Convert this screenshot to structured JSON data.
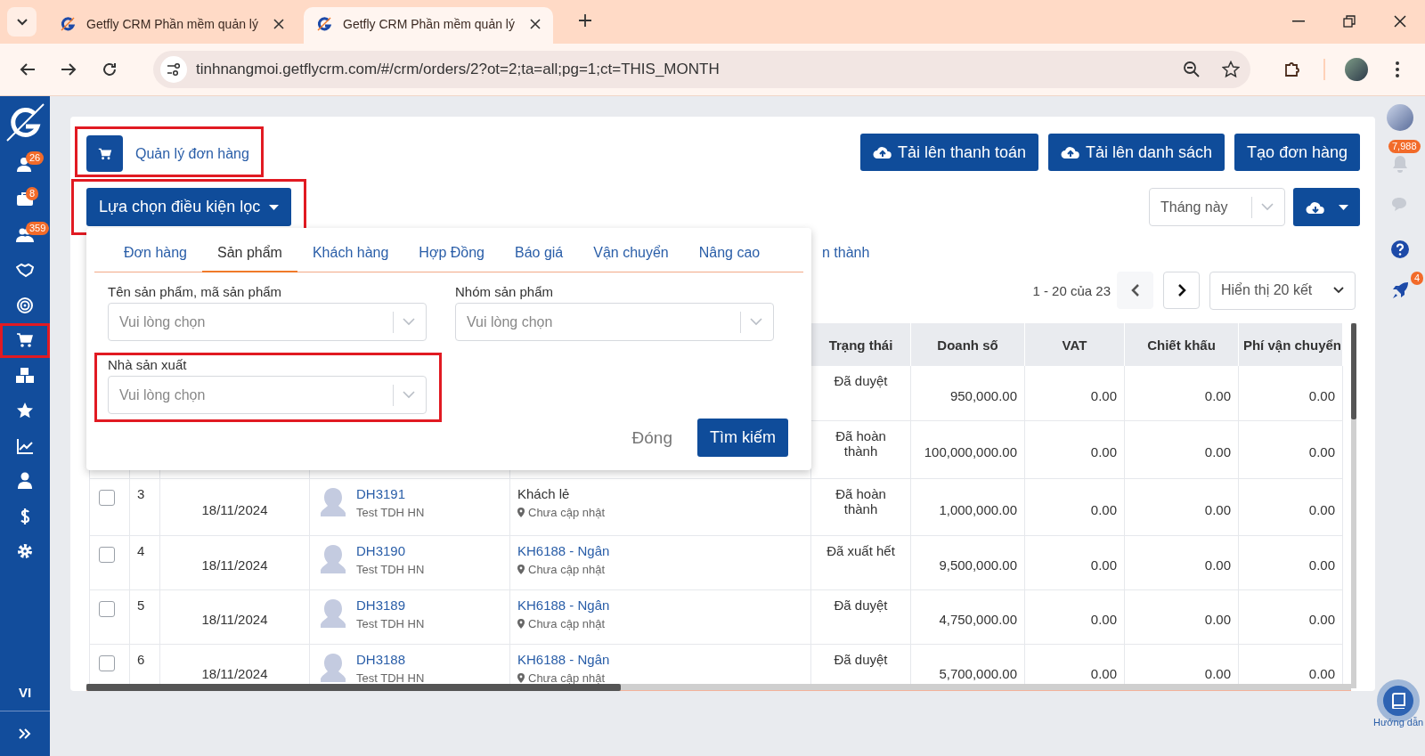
{
  "browser": {
    "tabs": [
      {
        "title": "Getfly CRM Phần mềm quản lý",
        "selected": false
      },
      {
        "title": "Getfly CRM Phần mềm quản lý",
        "selected": true
      }
    ],
    "url": "tinhnangmoi.getflycrm.com/#/crm/orders/2?ot=2;ta=all;pg=1;ct=THIS_MONTH"
  },
  "sidebar": {
    "items": [
      {
        "badge": "26",
        "highlighted": false
      },
      {
        "badge": "8",
        "highlighted": false
      },
      {
        "badge": "359",
        "highlighted": false
      },
      {
        "highlighted": false
      },
      {
        "highlighted": false
      },
      {
        "highlighted": true
      },
      {
        "highlighted": false
      },
      {
        "highlighted": false
      },
      {
        "highlighted": false
      },
      {
        "highlighted": false
      },
      {
        "highlighted": false
      },
      {
        "highlighted": false
      }
    ],
    "language": "VI"
  },
  "page": {
    "title": "Quản lý đơn hàng",
    "title_highlighted": true,
    "filter_button": {
      "label": "Lựa chọn điều kiện lọc",
      "highlighted": true
    },
    "actions": [
      {
        "label": "Tải lên thanh toán",
        "kind": "upload"
      },
      {
        "label": "Tải lên danh sách",
        "kind": "upload"
      },
      {
        "label": "Tạo đơn hàng",
        "kind": "plain"
      }
    ],
    "period_select": {
      "value": "Tháng này"
    },
    "status_tab_fragment": "n thành",
    "pagination": {
      "range": "1 - 20 của 23",
      "page_size": "Hiển thị 20 kết"
    }
  },
  "filter_panel": {
    "tabs": [
      {
        "label": "Đơn hàng",
        "selected": false
      },
      {
        "label": "Sản phẩm",
        "selected": true
      },
      {
        "label": "Khách hàng",
        "selected": false
      },
      {
        "label": "Hợp Đồng",
        "selected": false
      },
      {
        "label": "Báo giá",
        "selected": false
      },
      {
        "label": "Vận chuyển",
        "selected": false
      },
      {
        "label": "Nâng cao",
        "selected": false
      }
    ],
    "fields": [
      {
        "label": "Tên sản phẩm, mã sản phẩm",
        "placeholder": "Vui lòng chọn",
        "highlighted": false
      },
      {
        "label": "Nhóm sản phẩm",
        "placeholder": "Vui lòng chọn",
        "highlighted": false
      },
      {
        "label": "Nhà sản xuất",
        "placeholder": "Vui lòng chọn",
        "highlighted": true
      }
    ],
    "close": "Đóng",
    "search": "Tìm kiếm"
  },
  "table": {
    "columns": [
      "Trạng thái",
      "Doanh số",
      "VAT",
      "Chiết khấu",
      "Phí vận chuyển"
    ],
    "rows": [
      {
        "status": "Đã duyệt",
        "revenue": "950,000.00",
        "vat": "0.00",
        "discount": "0.00",
        "shipping": "0.00"
      },
      {
        "status": "Đã hoàn thành",
        "revenue": "100,000,000.00",
        "vat": "0.00",
        "discount": "0.00",
        "shipping": "0.00"
      },
      {
        "checked": false,
        "index": "3",
        "date": "18/11/2024",
        "order_code": "DH3191",
        "creator": "Test TDH HN",
        "customer": {
          "name": "Khách lẻ",
          "linked": false
        },
        "location": "Chưa cập nhật",
        "status": "Đã hoàn thành",
        "revenue": "1,000,000.00",
        "vat": "0.00",
        "discount": "0.00",
        "shipping": "0.00"
      },
      {
        "checked": false,
        "index": "4",
        "date": "18/11/2024",
        "order_code": "DH3190",
        "creator": "Test TDH HN",
        "customer": {
          "name": "KH6188 - Ngân",
          "linked": true
        },
        "location": "Chưa cập nhật",
        "status": "Đã xuất hết",
        "revenue": "9,500,000.00",
        "vat": "0.00",
        "discount": "0.00",
        "shipping": "0.00"
      },
      {
        "checked": false,
        "index": "5",
        "date": "18/11/2024",
        "order_code": "DH3189",
        "creator": "Test TDH HN",
        "customer": {
          "name": "KH6188 - Ngân",
          "linked": true
        },
        "location": "Chưa cập nhật",
        "status": "Đã duyệt",
        "revenue": "4,750,000.00",
        "vat": "0.00",
        "discount": "0.00",
        "shipping": "0.00"
      },
      {
        "checked": false,
        "index": "6",
        "date": "18/11/2024",
        "order_code": "DH3188",
        "creator": "Test TDH HN",
        "customer": {
          "name": "KH6188 - Ngân",
          "linked": true
        },
        "location": "Chưa cập nhật",
        "status": "Đã duyệt",
        "revenue": "5,700,000.00",
        "vat": "0.00",
        "discount": "0.00",
        "shipping": "0.00"
      }
    ]
  },
  "right_rail": {
    "notifications_badge": "7,988",
    "rocket_badge": "4",
    "guide_label": "Hướng dẫn"
  }
}
